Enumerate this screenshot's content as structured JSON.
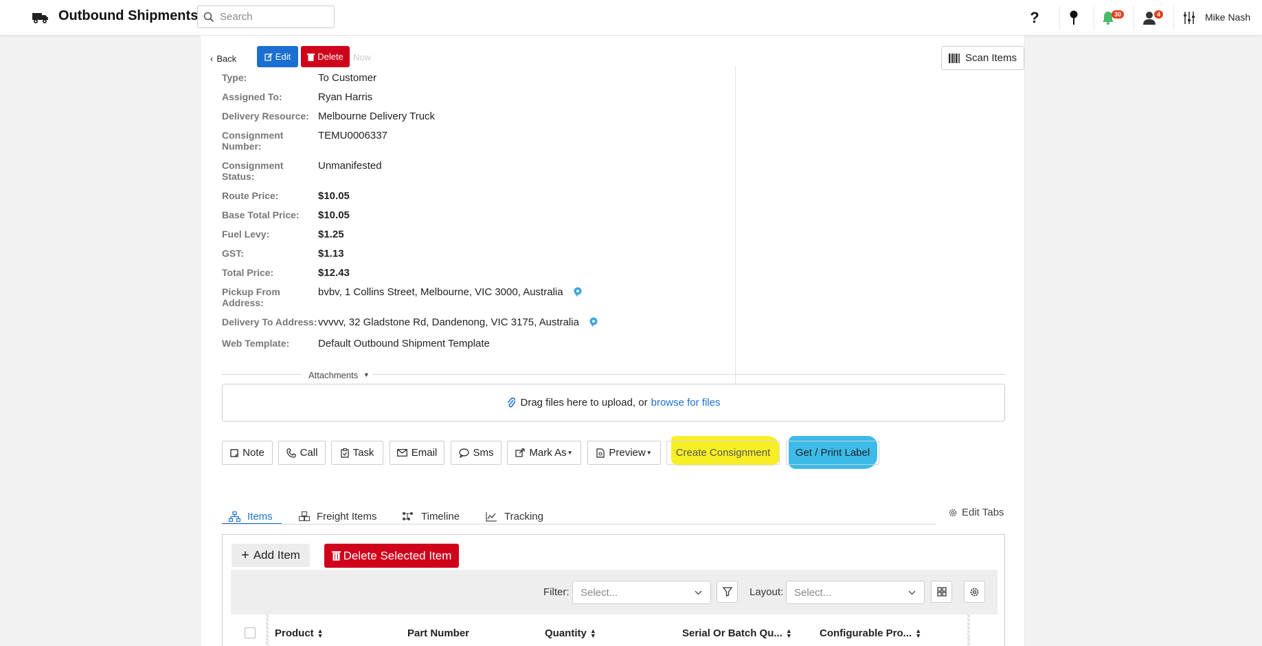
{
  "header": {
    "title": "Outbound Shipments",
    "search_placeholder": "Search",
    "notifications_count": "30",
    "users_count": "4",
    "user_name": "Mike Nash"
  },
  "toolbar": {
    "back_label": "Back",
    "edit_label": "Edit",
    "delete_label": "Delete",
    "obscured_text": "Now",
    "scan_label": "Scan Items"
  },
  "details": [
    {
      "label": "Type:",
      "value": "To Customer",
      "bold": false
    },
    {
      "label": "Assigned To:",
      "value": "Ryan Harris",
      "bold": false
    },
    {
      "label": "Delivery Resource:",
      "value": "Melbourne Delivery Truck",
      "bold": false
    },
    {
      "label": "Consignment Number:",
      "value": "TEMU0006337",
      "bold": false
    },
    {
      "label": "Consignment Status:",
      "value": "Unmanifested",
      "bold": false
    },
    {
      "label": "Route Price:",
      "value": "$10.05",
      "bold": true
    },
    {
      "label": "Base Total Price:",
      "value": "$10.05",
      "bold": true
    },
    {
      "label": "Fuel Levy:",
      "value": "$1.25",
      "bold": true
    },
    {
      "label": "GST:",
      "value": "$1.13",
      "bold": true
    },
    {
      "label": "Total Price:",
      "value": "$12.43",
      "bold": true
    },
    {
      "label": "Pickup From Address:",
      "value": "bvbv, 1 Collins Street, Melbourne, VIC 3000, Australia",
      "bold": false
    },
    {
      "label": "Delivery To Address:",
      "value": "vvvvv, 32 Gladstone Rd, Dandenong, VIC 3175, Australia",
      "bold": false
    },
    {
      "label": "Web Template:",
      "value": "Default Outbound Shipment Template",
      "bold": false
    }
  ],
  "attachments": {
    "title": "Attachments",
    "drop_text": "Drag files here to upload, or",
    "browse_link": "browse for files"
  },
  "actions": {
    "note": "Note",
    "call": "Call",
    "task": "Task",
    "email": "Email",
    "sms": "Sms",
    "mark_as": "Mark As",
    "preview": "Preview",
    "create_consignment": "Create Consignment",
    "print_label": "Get / Print Label"
  },
  "tabs": {
    "items": "Items",
    "freight_items": "Freight Items",
    "timeline": "Timeline",
    "tracking": "Tracking",
    "edit_tabs": "Edit Tabs"
  },
  "items_panel": {
    "add_item": "Add Item",
    "delete_selected": "Delete Selected Item",
    "filter_label": "Filter:",
    "filter_placeholder": "Select...",
    "layout_label": "Layout:",
    "layout_placeholder": "Select...",
    "columns": [
      "Product",
      "Part Number",
      "Quantity",
      "Serial Or Batch Qu...",
      "Configurable Pro..."
    ]
  },
  "colors": {
    "primary": "#1a6fd1",
    "danger": "#d0021b",
    "highlight_yellow": "#f7ef26",
    "highlight_blue": "#3cbbe8",
    "badge": "#e0401a"
  }
}
